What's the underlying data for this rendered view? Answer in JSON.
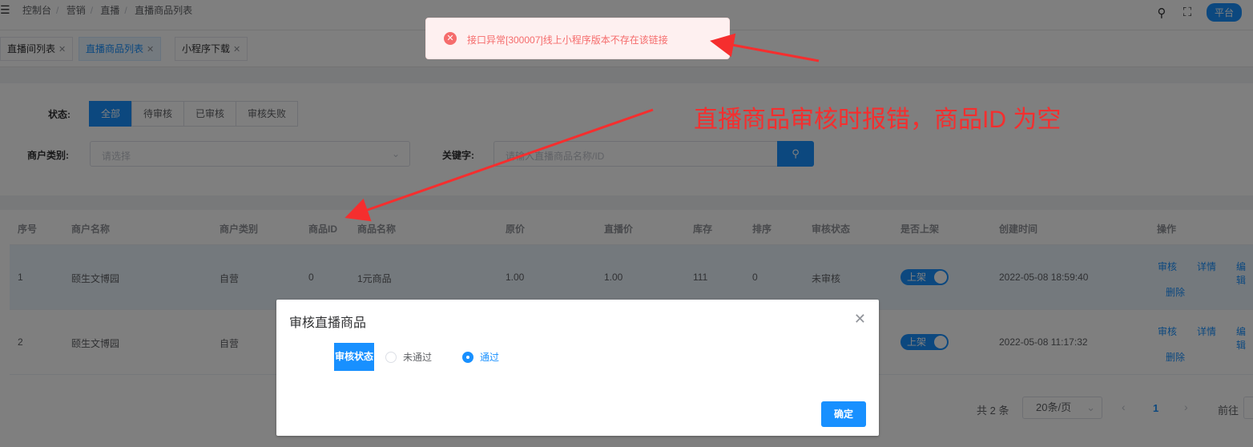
{
  "header": {
    "breadcrumb": [
      "控制台",
      "营销",
      "直播",
      "直播商品列表"
    ],
    "platform_label": "平台"
  },
  "tags": [
    {
      "label": "直播间列表"
    },
    {
      "label": "直播商品列表"
    },
    {
      "label": "小程序下载"
    }
  ],
  "filters": {
    "status_label": "状态:",
    "status_options": [
      "全部",
      "待审核",
      "已审核",
      "审核失败"
    ],
    "merchant_type_label": "商户类别:",
    "merchant_type_placeholder": "请选择",
    "keyword_label": "关键字:",
    "keyword_placeholder": "请输入直播商品名称/ID"
  },
  "table": {
    "columns": [
      "序号",
      "商户名称",
      "商户类别",
      "商品ID",
      "商品名称",
      "原价",
      "直播价",
      "库存",
      "排序",
      "审核状态",
      "是否上架",
      "创建时间",
      "操作"
    ],
    "rows": [
      {
        "index": "1",
        "merchant": "颐生文博园",
        "type": "自营",
        "product_id": "0",
        "product_name": "1元商品",
        "price": "1.00",
        "live_price": "1.00",
        "stock": "111",
        "sort": "0",
        "audit_status": "未审核",
        "on_shelf": "上架",
        "created": "2022-05-08 18:59:40"
      },
      {
        "index": "2",
        "merchant": "颐生文博园",
        "type": "自营",
        "on_shelf": "上架",
        "created": "2022-05-08 11:17:32"
      }
    ],
    "actions": [
      "审核",
      "详情",
      "编辑",
      "删除"
    ]
  },
  "pagination": {
    "total_text": "共 2 条",
    "page_size": "20条/页",
    "current_page": "1",
    "goto_label": "前往"
  },
  "toast": {
    "message": "接口异常[300007]线上小程序版本不存在该链接"
  },
  "dialog": {
    "title": "审核直播商品",
    "field_label": "审核状态",
    "options": [
      "未通过",
      "通过"
    ],
    "selected": "通过",
    "confirm_label": "确定"
  },
  "annotation": {
    "text": "直播商品审核时报错，商品ID 为空",
    "color": "#f52e2e"
  },
  "colors": {
    "primary": "#1890ff",
    "error": "#f56c6c"
  }
}
